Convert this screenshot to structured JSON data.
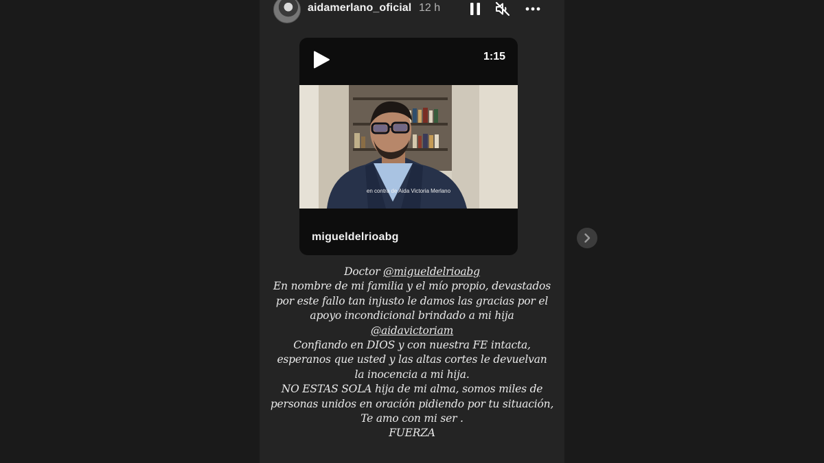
{
  "header": {
    "username": "aidamerlano_oficial",
    "time": "12 h",
    "pause_icon": "pause-icon",
    "mute_icon": "volume-muted-icon",
    "more_icon": "more-horizontal-icon"
  },
  "embed": {
    "duration": "1:15",
    "subtitle": "en contra de Aida Victoria Merlano",
    "username": "migueldelrioabg"
  },
  "caption": {
    "line1_prefix": "Doctor ",
    "line1_mention": "@migueldelrioabg",
    "line2": "En nombre de mi familia y el mío propio, devastados",
    "line3": "por este fallo tan injusto le damos las gracias por el",
    "line4": "apoyo incondicional brindado  a mi hija",
    "line5_mention": "@aidavictoriam",
    "line6": "Confiando en DIOS  y con nuestra FE   intacta,",
    "line7": "esperanos que usted  y  las altas cortes le devuelvan",
    "line8": "la inocencia a mi hija.",
    "line9": "NO ESTAS SOLA hija de mi alma, somos miles de",
    "line10": "personas unidos en oración pidiendo por tu situación,",
    "line11": "Te amo con mi ser .",
    "line12": "FUERZA"
  },
  "colors": {
    "page_bg": "#1a1a1a",
    "story_bg": "#242424",
    "embed_bg": "#0d0d0d",
    "text": "#eaeaea"
  }
}
